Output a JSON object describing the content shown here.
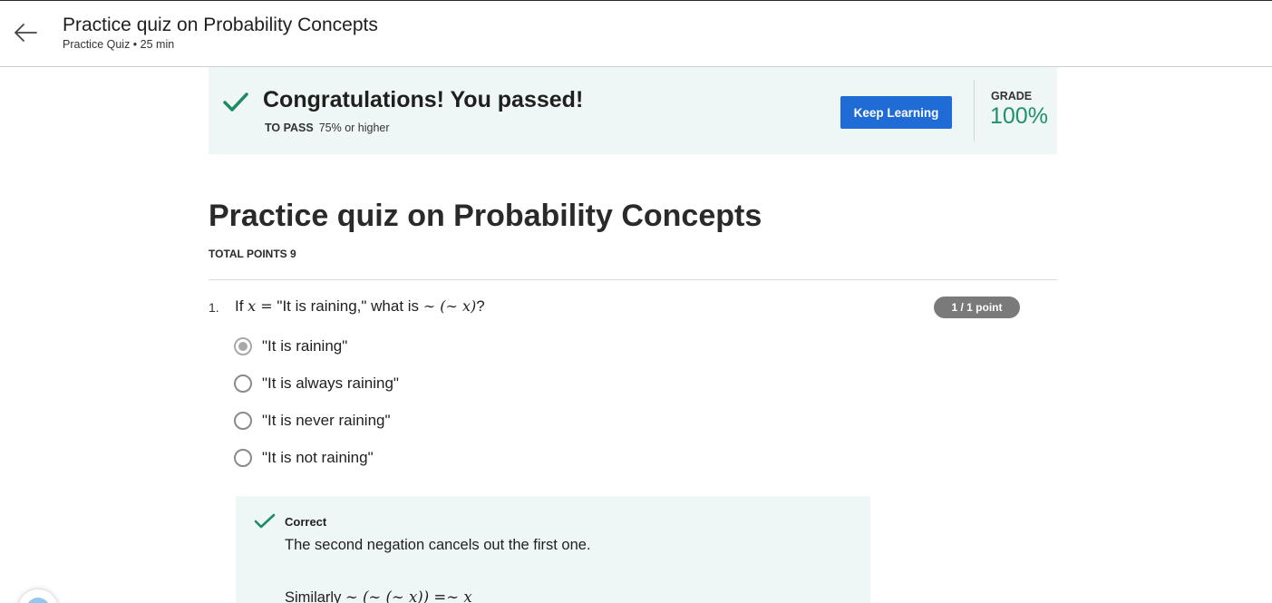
{
  "header": {
    "title": "Practice quiz on Probability Concepts",
    "subtitle": "Practice Quiz • 25 min"
  },
  "banner": {
    "title": "Congratulations! You passed!",
    "to_pass_label": "TO PASS",
    "to_pass_value": "75% or higher",
    "keep_learning_label": "Keep Learning",
    "grade_label": "GRADE",
    "grade_value": "100%"
  },
  "quiz": {
    "title": "Practice quiz on Probability Concepts",
    "total_points": "TOTAL POINTS 9"
  },
  "question": {
    "number": "1.",
    "text_prefix": "If ",
    "math_x": "x =",
    "text_middle": " \"It is raining,\" what is ",
    "math_expr": "∼ (∼ x)",
    "text_suffix": "?",
    "points": "1 / 1 point",
    "options": [
      {
        "label": "\"It is raining\"",
        "selected": true
      },
      {
        "label": "\"It is always raining\"",
        "selected": false
      },
      {
        "label": "\"It is never raining\"",
        "selected": false
      },
      {
        "label": "\"It is not raining\"",
        "selected": false
      }
    ]
  },
  "feedback": {
    "status": "Correct",
    "explanation": "The second negation cancels out the first one.",
    "similarly_prefix": "Similarly ",
    "similarly_math": "∼ (∼ (∼ x)) =∼ x"
  },
  "colors": {
    "accent": "#1f6cd6",
    "success": "#1f9166",
    "banner_bg": "#eef7f5",
    "badge_bg": "#7a7a7a"
  },
  "icons": {
    "back": "arrow-left-icon",
    "pass": "checkmark-icon",
    "correct": "checkmark-icon",
    "help": "help-icon"
  }
}
